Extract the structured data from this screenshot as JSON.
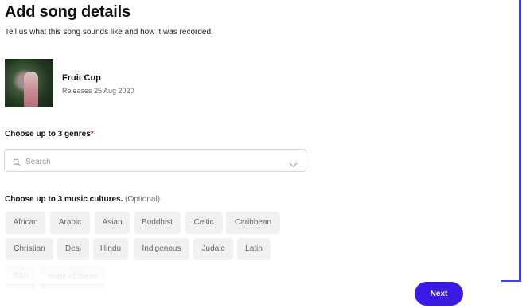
{
  "header": {
    "title": "Add song details",
    "subtitle": "Tell us what this song sounds like and how it was recorded."
  },
  "song": {
    "title": "Fruit Cup",
    "release": "Releases 25 Aug 2020"
  },
  "genres": {
    "label": "Choose up to 3 genres",
    "required_mark": "*",
    "search_placeholder": "Search"
  },
  "cultures": {
    "label": "Choose up to 3 music cultures.",
    "optional": "(Optional)",
    "chips": [
      "African",
      "Arabic",
      "Asian",
      "Buddhist",
      "Celtic",
      "Caribbean",
      "Christian",
      "Desi",
      "Hindu",
      "Indigenous",
      "Judaic",
      "Latin",
      "Sikh",
      "None of these"
    ]
  },
  "footer": {
    "next_label": "Next"
  },
  "colors": {
    "accent": "#3d19e6",
    "frame": "#3d3cff",
    "required": "#e22134"
  },
  "icons": {
    "search": "search-icon",
    "dropdown": "chevron-down-icon"
  }
}
